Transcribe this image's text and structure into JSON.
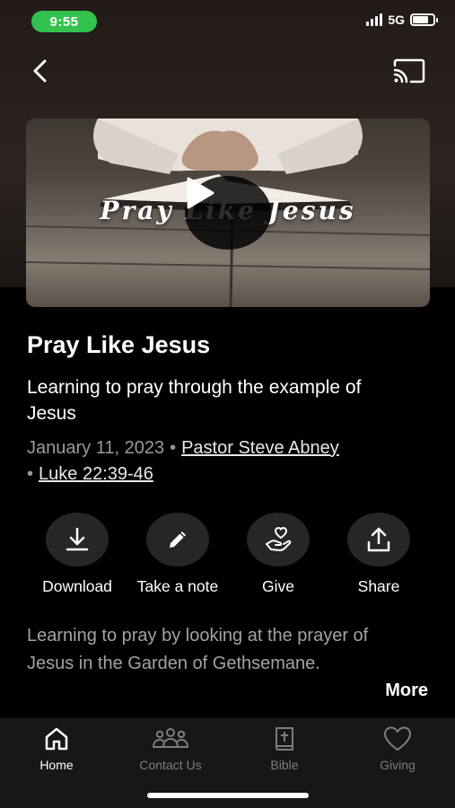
{
  "status_bar": {
    "time": "9:55",
    "network": "5G",
    "battery_level": 0.75
  },
  "nav": {
    "back_icon": "chevron-left-icon",
    "cast_icon": "cast-icon"
  },
  "video": {
    "thumbnail_text": "Pray Like Jesus",
    "play_icon": "play-icon"
  },
  "sermon": {
    "title": "Pray Like Jesus",
    "subtitle": "Learning to pray through the example of Jesus",
    "date": "January 11, 2023",
    "speaker": "Pastor Steve Abney",
    "scripture": "Luke 22:39-46",
    "description": "Learning to pray by looking at the prayer of Jesus in the Garden of Gethsemane.",
    "more_label": "More"
  },
  "actions": [
    {
      "label": "Download",
      "icon": "download-icon"
    },
    {
      "label": "Take a note",
      "icon": "pencil-icon"
    },
    {
      "label": "Give",
      "icon": "give-hand-heart-icon"
    },
    {
      "label": "Share",
      "icon": "share-icon"
    }
  ],
  "tabs": [
    {
      "label": "Home",
      "icon": "home-icon",
      "active": true
    },
    {
      "label": "Contact Us",
      "icon": "people-icon",
      "active": false
    },
    {
      "label": "Bible",
      "icon": "bible-icon",
      "active": false
    },
    {
      "label": "Giving",
      "icon": "heart-icon",
      "active": false
    }
  ],
  "colors": {
    "accent_green": "#33c24d",
    "background": "#000000",
    "tab_bar": "#171717"
  }
}
